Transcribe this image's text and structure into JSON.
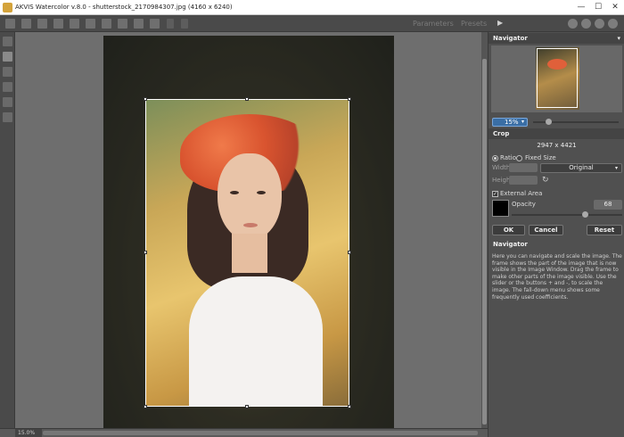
{
  "window": {
    "title": "AKVIS Watercolor v.8.0 - shutterstock_2170984307.jpg (4160 x 6240)",
    "minimize_glyph": "—",
    "maximize_glyph": "☐",
    "close_glyph": "✕"
  },
  "toolbar": {
    "parameters_label": "Parameters",
    "presets_label": "Presets",
    "play_glyph": "▶"
  },
  "status": {
    "zoom": "15.0%"
  },
  "navigator": {
    "header": "Navigator",
    "caret": "▾",
    "zoom_value": "15%",
    "zoom_slider_fraction": 0.15
  },
  "crop": {
    "header": "Crop",
    "dimensions": "2947 x 4421",
    "ratio_label": "Ratio",
    "fixed_size_label": "Fixed Size",
    "width_label": "Width",
    "height_label": "Height",
    "preset_value": "Original",
    "external_area_label": "External Area",
    "opacity_label": "Opacity",
    "opacity_value": "68",
    "ok_label": "OK",
    "cancel_label": "Cancel",
    "reset_label": "Reset"
  },
  "help": {
    "header": "Navigator",
    "text": "Here you can navigate and scale the image. The frame shows the part of the image that is now visible in the Image Window. Drag the frame to make other parts of the image visible. Use the slider or the buttons + and -, to scale the image. The fall-down menu shows some frequently used coefficients."
  },
  "colors": {
    "accent": "#3a6ea5",
    "panel": "#505050",
    "canvas": "#6e6e6e"
  }
}
